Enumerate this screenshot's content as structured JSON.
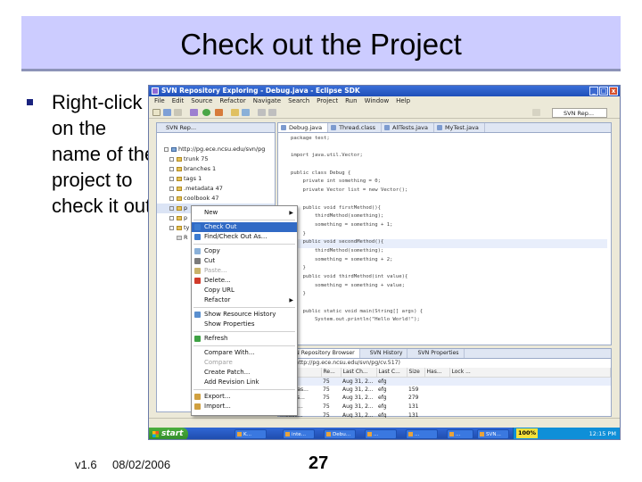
{
  "slide": {
    "title": "Check out the Project",
    "bullet": "Right-click on the name of the project to check it out.",
    "footer_version": "v1.6",
    "footer_date": "08/02/2006",
    "page_number": "27",
    "header_color": "#ccccff"
  },
  "window": {
    "title": "SVN Repository Exploring - Debug.java - Eclipse SDK",
    "menu": [
      "File",
      "Edit",
      "Source",
      "Refactor",
      "Navigate",
      "Search",
      "Project",
      "Run",
      "Window",
      "Help"
    ],
    "perspective_label": "SVN Rep...",
    "controls": {
      "minimize": "_",
      "maximize": "□",
      "close": "x"
    }
  },
  "left_view": {
    "tab_label": "SVN Rep...",
    "tree": [
      {
        "label": "http://pg.ece.ncsu.edu/svn/pg"
      },
      {
        "label": "trunk 75"
      },
      {
        "label": "branches 1"
      },
      {
        "label": "tags 1"
      },
      {
        "label": ".metadata 47"
      },
      {
        "label": "coolbook 47"
      },
      {
        "label": "p"
      },
      {
        "label": "p"
      },
      {
        "label": "ty"
      },
      {
        "label": "R"
      }
    ]
  },
  "context_menu": {
    "items": [
      {
        "label": "New",
        "submenu": true,
        "icon": "none"
      },
      {
        "label": "Check Out",
        "selected": true,
        "icon": "checkout-icon"
      },
      {
        "label": "Find/Check Out As...",
        "icon": "find-checkout-icon"
      },
      {
        "label": "Copy",
        "icon": "copy-icon"
      },
      {
        "label": "Cut",
        "icon": "cut-icon"
      },
      {
        "label": "Paste...",
        "disabled": true,
        "icon": "paste-icon"
      },
      {
        "label": "Delete...",
        "icon": "delete-icon"
      },
      {
        "label": "Copy URL",
        "icon": "none"
      },
      {
        "label": "Refactor",
        "submenu": true,
        "icon": "none"
      },
      {
        "label": "Show Resource History",
        "icon": "history-icon"
      },
      {
        "label": "Show Properties",
        "icon": "none"
      },
      {
        "label": "Refresh",
        "icon": "refresh-icon"
      },
      {
        "label": "Compare With...",
        "icon": "none"
      },
      {
        "label": "Compare",
        "disabled": true,
        "icon": "none"
      },
      {
        "label": "Create Patch...",
        "icon": "none"
      },
      {
        "label": "Add Revision Link",
        "icon": "none"
      },
      {
        "label": "Export...",
        "icon": "export-icon"
      },
      {
        "label": "Import...",
        "icon": "import-icon"
      }
    ]
  },
  "editor": {
    "tabs": [
      "Debug.java",
      "Thread.class",
      "AllTests.java",
      "MyTest.java"
    ],
    "code": [
      "package test;",
      "",
      "import java.util.Vector;",
      "",
      "public class Debug {",
      "    private int something = 0;",
      "    private Vector list = new Vector();",
      "",
      "    public void firstMethod(){",
      "        thirdMethod(something);",
      "        something = something + 1;",
      "    }",
      "    public void secondMethod(){",
      "        thirdMethod(something);",
      "        something = something + 2;",
      "    }",
      "    public void thirdMethod(int value){",
      "        something = something + value;",
      "    }",
      "",
      "    public static void main(String[] args) {",
      "        System.out.println(\"Hello World!\");"
    ]
  },
  "bottom_view": {
    "tabs": [
      "SVN Repository Browser",
      "SVN History",
      "SVN Properties"
    ],
    "address": "...ign http://pg.ece.ncsu.edu/svn/pg/cv.517)",
    "columns": [
      "",
      "Re...",
      "Last Ch...",
      "Last C...",
      "Size",
      "Has...",
      "Lock ..."
    ],
    "rows": [
      [
        "...",
        "75",
        "Aug 31, 2...",
        "efg",
        "",
        "",
        ""
      ],
      [
        "...m.Clas...",
        "75",
        "Aug 31, 2...",
        "efg",
        "159",
        "",
        ""
      ],
      [
        "...nClas...",
        "75",
        "Aug 31, 2...",
        "efg",
        "279",
        "",
        ""
      ],
      [
        "...dase...",
        "75",
        "Aug 31, 2...",
        "efg",
        "131",
        "",
        ""
      ],
      [
        "...ease...",
        "75",
        "Aug 31, 2...",
        "efg",
        "131",
        "",
        ""
      ]
    ]
  },
  "taskbar": {
    "start_label": "start",
    "items": [
      "K...",
      "inte...",
      "Debu...",
      "...",
      "...",
      "...",
      "SVN..."
    ],
    "tray_percent": "100%",
    "tray_time": "12:15 PM"
  }
}
